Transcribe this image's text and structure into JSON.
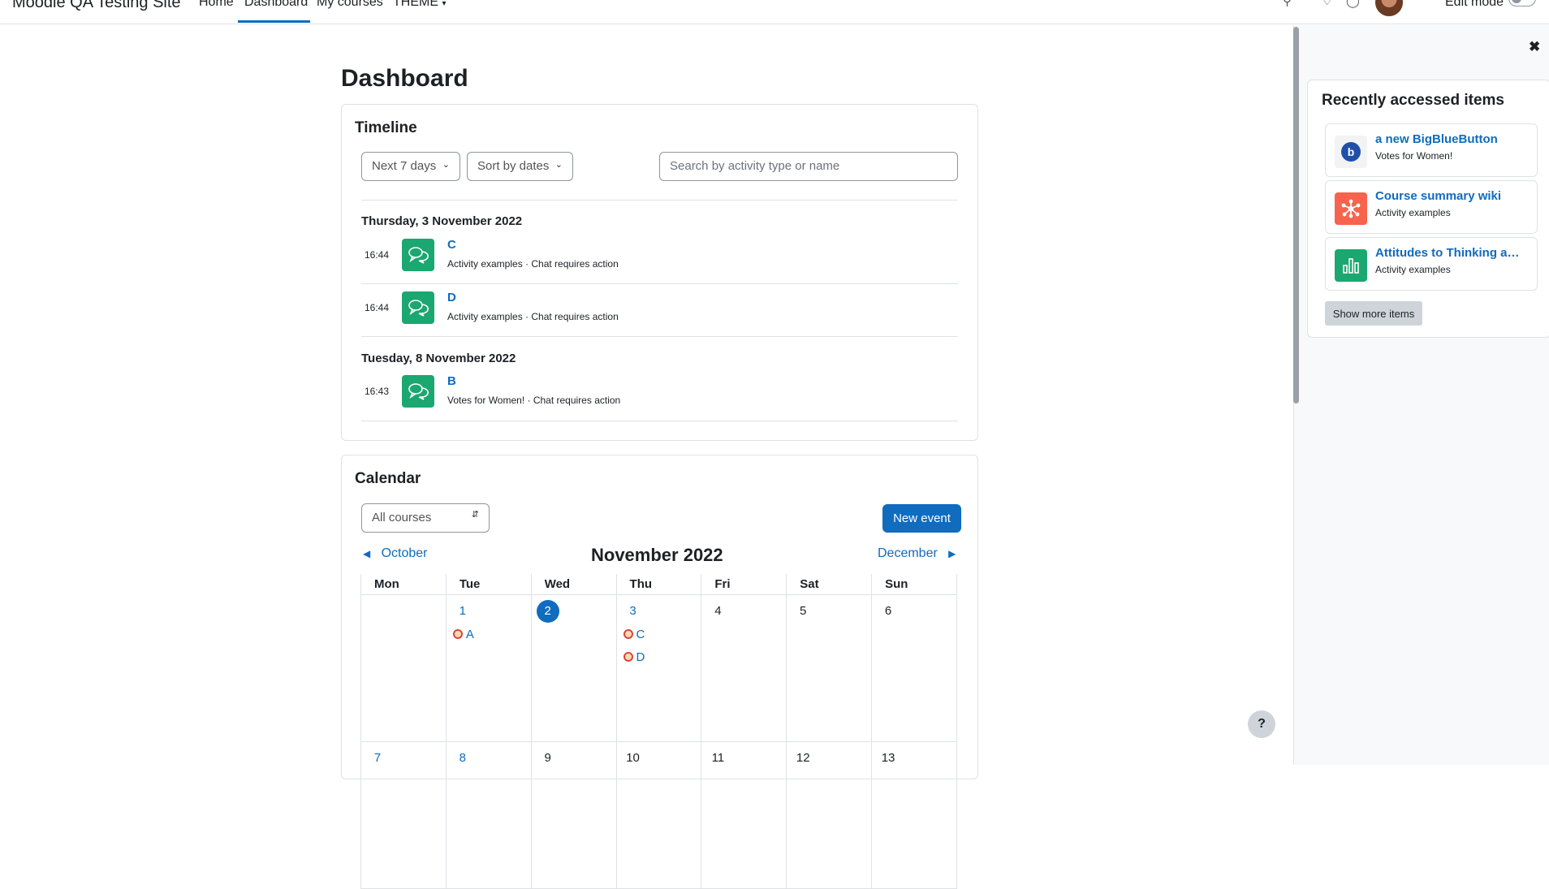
{
  "navbar": {
    "brand": "Moodle QA Testing Site",
    "links": [
      "Home",
      "Dashboard",
      "My courses",
      "THEME"
    ],
    "edit_mode_label": "Edit mode"
  },
  "page_title": "Dashboard",
  "timeline": {
    "title": "Timeline",
    "filter_days": "Next 7 days",
    "sort": "Sort by dates",
    "search_placeholder": "Search by activity type or name",
    "groups": [
      {
        "date": "Thursday, 3 November 2022",
        "events": [
          {
            "time": "16:44",
            "name": "C",
            "meta": "Activity examples · Chat requires action"
          },
          {
            "time": "16:44",
            "name": "D",
            "meta": "Activity examples · Chat requires action"
          }
        ]
      },
      {
        "date": "Tuesday, 8 November 2022",
        "events": [
          {
            "time": "16:43",
            "name": "B",
            "meta": "Votes for Women! · Chat requires action"
          }
        ]
      }
    ]
  },
  "calendar": {
    "title": "Calendar",
    "course_filter": "All courses",
    "new_event": "New event",
    "prev_month": "October",
    "month": "November 2022",
    "next_month": "December",
    "weekdays": [
      "Mon",
      "Tue",
      "Wed",
      "Thu",
      "Fri",
      "Sat",
      "Sun"
    ],
    "week1": [
      "",
      "1",
      "2",
      "3",
      "4",
      "5",
      "6"
    ],
    "week2": [
      "7",
      "8",
      "9",
      "10",
      "11",
      "12",
      "13"
    ],
    "events": {
      "tue": [
        "A"
      ],
      "thu": [
        "C",
        "D"
      ]
    }
  },
  "drawer": {
    "title": "Recently accessed items",
    "items": [
      {
        "name": "a new BigBlueButton",
        "course": "Votes for Women!",
        "icon": "bigbluebutton-icon",
        "color": "#ffffff"
      },
      {
        "name": "Course summary wiki",
        "course": "Activity examples",
        "icon": "wiki-icon",
        "color": "#f7634d"
      },
      {
        "name": "Attitudes to Thinking a…",
        "course": "Activity examples",
        "icon": "chart-bars-icon",
        "color": "#1ba770"
      }
    ],
    "show_more": "Show more items"
  },
  "colors": {
    "primary": "#0f6cbf",
    "chat_green": "#1ba770"
  }
}
